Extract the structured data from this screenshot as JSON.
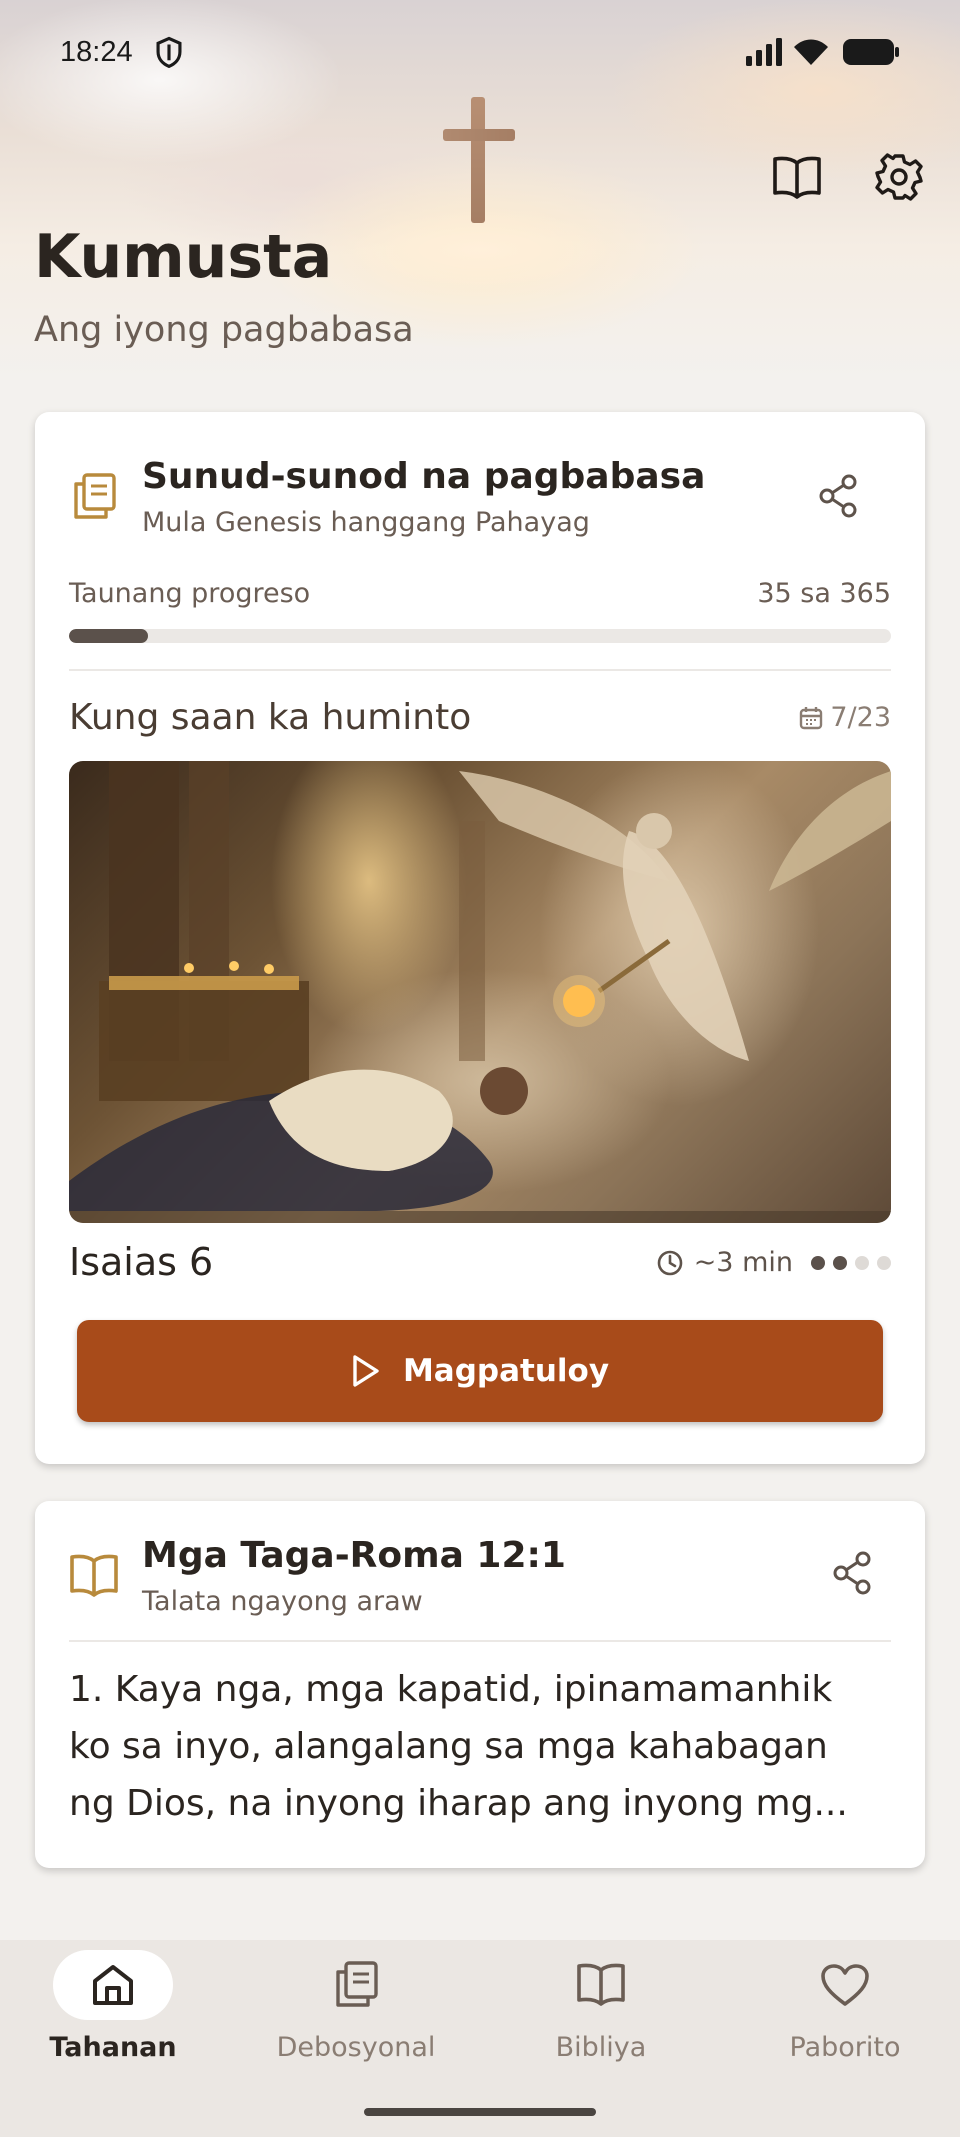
{
  "status_bar": {
    "time": "18:24"
  },
  "header": {
    "title": "Kumusta",
    "subtitle": "Ang iyong pagbabasa"
  },
  "top_actions": {
    "bible_icon": "open-book-icon",
    "settings_icon": "gear-icon"
  },
  "plan_card": {
    "title": "Sunud-sunod na pagbabasa",
    "subtitle": "Mula Genesis hanggang Pahayag",
    "progress_label": "Taunang progreso",
    "progress_value": "35 sa 365",
    "progress_fraction": 0.0959,
    "resume_label": "Kung saan ka huminto",
    "date": "7/23",
    "chapter": "Isaias 6",
    "duration": "~3 min",
    "dots_total": 4,
    "dots_filled": 2,
    "continue_label": "Magpatuloy"
  },
  "verse_card": {
    "title": "Mga Taga-Roma 12:1",
    "subtitle": "Talata ngayong araw",
    "lines": [
      "1. Kaya nga, mga kapatid, ipinamamanhik",
      "ko sa inyo, alangalang sa mga kahabagan",
      "ng Dios, na inyong iharap ang inyong mg..."
    ]
  },
  "nav": {
    "items": [
      {
        "label": "Tahanan",
        "icon": "home-icon",
        "active": true
      },
      {
        "label": "Debosyonal",
        "icon": "books-icon",
        "active": false
      },
      {
        "label": "Bibliya",
        "icon": "open-book-icon",
        "active": false
      },
      {
        "label": "Paborito",
        "icon": "heart-icon",
        "active": false
      }
    ]
  },
  "colors": {
    "accent": "#a84b1a",
    "progress": "#5b514b",
    "icon_gold": "#b88a3c"
  }
}
